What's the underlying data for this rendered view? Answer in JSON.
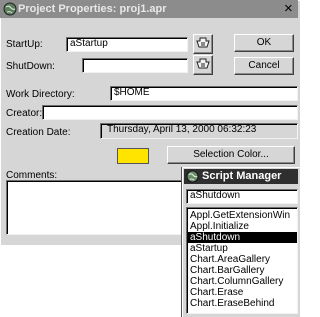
{
  "project_dialog": {
    "title": "Project Properties:   proj1.apr",
    "close_glyph": "×",
    "startup_label": "StartUp:",
    "startup_value": "aStartup",
    "shutdown_label": "ShutDown:",
    "shutdown_value": "",
    "ok_label": "OK",
    "cancel_label": "Cancel",
    "workdir_label": "Work Directory:",
    "workdir_value": "$HOME",
    "creator_label": "Creator:",
    "creator_value": "",
    "creation_date_label": "Creation Date:",
    "creation_date_value": "Thursday, April 13, 2000 06:32:23",
    "selection_color": "#ffe400",
    "selection_color_button": "Selection Color...",
    "comments_label": "Comments:",
    "comments_value": ""
  },
  "script_manager": {
    "title": "Script Manager",
    "current_value": "aShutdown",
    "items": [
      "Appl.GetExtensionWin",
      "Appl.Initialize",
      "aShutdown",
      "aStartup",
      "Chart.AreaGallery",
      "Chart.BarGallery",
      "Chart.ColumnGallery",
      "Chart.Erase",
      "Chart.EraseBehind"
    ],
    "selected_index": 2,
    "icon": "globe-icon"
  },
  "colors": {
    "title_bar": "#8c8c8c",
    "active_title_bar": "#2f2f2f",
    "dialog_face": "#d6d6d6"
  }
}
